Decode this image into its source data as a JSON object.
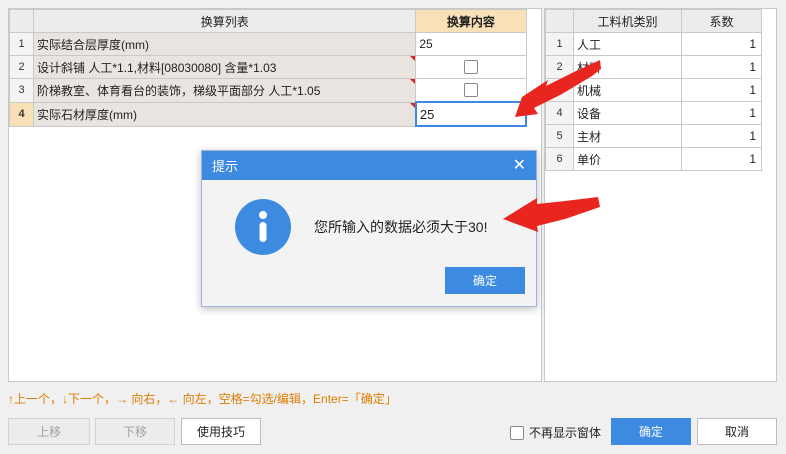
{
  "left_table": {
    "header_list": "换算列表",
    "header_content": "换算内容",
    "rows": [
      {
        "no": "1",
        "desc": "实际结合层厚度(mm)",
        "value": "25",
        "type": "text"
      },
      {
        "no": "2",
        "desc": "设计斜铺 人工*1.1,材料[08030080] 含量*1.03",
        "value": "",
        "type": "checkbox"
      },
      {
        "no": "3",
        "desc": "阶梯教室、体育看台的装饰，梯级平面部分 人工*1.05",
        "value": "",
        "type": "checkbox"
      },
      {
        "no": "4",
        "desc": "实际石材厚度(mm)",
        "value": "25",
        "type": "text"
      }
    ]
  },
  "right_table": {
    "header_category": "工料机类别",
    "header_coef": "系数",
    "rows": [
      {
        "no": "1",
        "category": "人工",
        "coef": "1"
      },
      {
        "no": "2",
        "category": "材料",
        "coef": "1"
      },
      {
        "no": "3",
        "category": "机械",
        "coef": "1"
      },
      {
        "no": "4",
        "category": "设备",
        "coef": "1"
      },
      {
        "no": "5",
        "category": "主材",
        "coef": "1"
      },
      {
        "no": "6",
        "category": "单价",
        "coef": "1"
      }
    ]
  },
  "hint": "↑上一个，↓下一个，→ 向右，← 向左，空格=勾选/编辑，Enter=「确定」",
  "buttons": {
    "move_up": "上移",
    "move_down": "下移",
    "tips": "使用技巧",
    "ok": "确定",
    "cancel": "取消"
  },
  "no_show_again": "不再显示窗体",
  "dialog": {
    "title": "提示",
    "message": "您所输入的数据必须大于30!",
    "ok": "确定",
    "icon": "info-icon"
  },
  "colors": {
    "accent": "#3c8be0",
    "highlight": "#f9e1b7",
    "arrow": "#e8261f",
    "hint": "#e07b00"
  }
}
